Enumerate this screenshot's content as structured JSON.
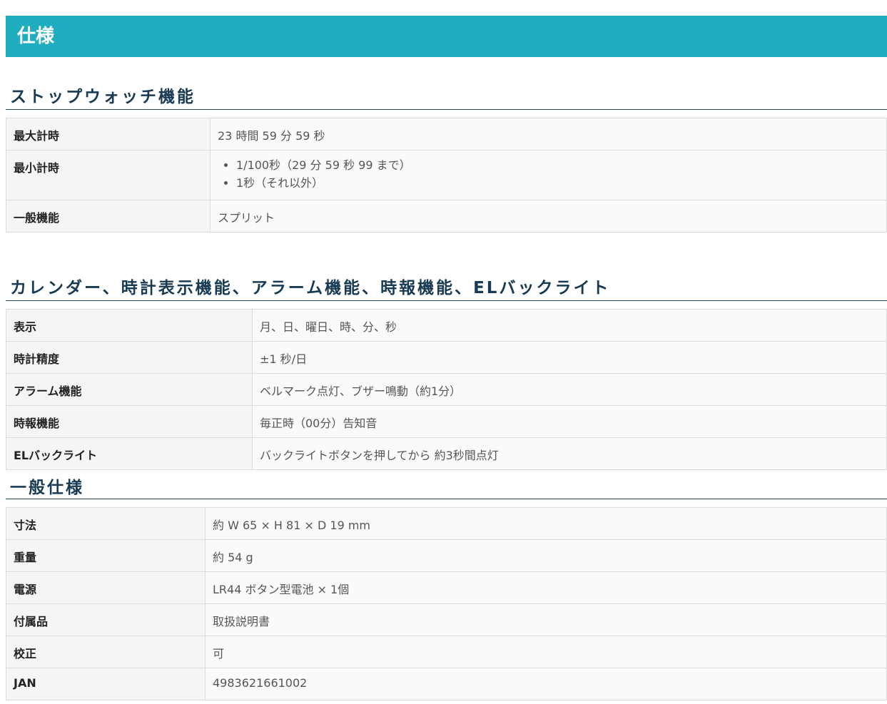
{
  "page_title": "仕様",
  "sections": [
    {
      "title": "ストップウォッチ機能",
      "rows": [
        {
          "label": "最大計時",
          "value": "23 時間 59 分 59 秒"
        },
        {
          "label": "最小計時",
          "items": [
            "1/100秒（29 分 59 秒 99 まで）",
            "1秒（それ以外）"
          ]
        },
        {
          "label": "一般機能",
          "value": "スプリット"
        }
      ]
    },
    {
      "title": "カレンダー、時計表示機能、アラーム機能、時報機能、ELバックライト",
      "rows": [
        {
          "label": "表示",
          "value": "月、日、曜日、時、分、秒"
        },
        {
          "label": "時計精度",
          "value": "±1 秒/日"
        },
        {
          "label": "アラーム機能",
          "value": "ベルマーク点灯、ブザー鳴動（約1分）"
        },
        {
          "label": "時報機能",
          "value": "毎正時（00分）告知音"
        },
        {
          "label": "ELバックライト",
          "value": "バックライトボタンを押してから 約3秒間点灯"
        }
      ]
    },
    {
      "title": "一般仕様",
      "rows": [
        {
          "label": "寸法",
          "value": "約 W 65 × H 81 × D 19 mm"
        },
        {
          "label": "重量",
          "value": "約 54 g"
        },
        {
          "label": "電源",
          "value": "LR44 ボタン型電池 × 1個"
        },
        {
          "label": "付属品",
          "value": "取扱説明書"
        },
        {
          "label": "校正",
          "value": "可"
        },
        {
          "label": "JAN",
          "value": "4983621661002"
        }
      ]
    }
  ]
}
